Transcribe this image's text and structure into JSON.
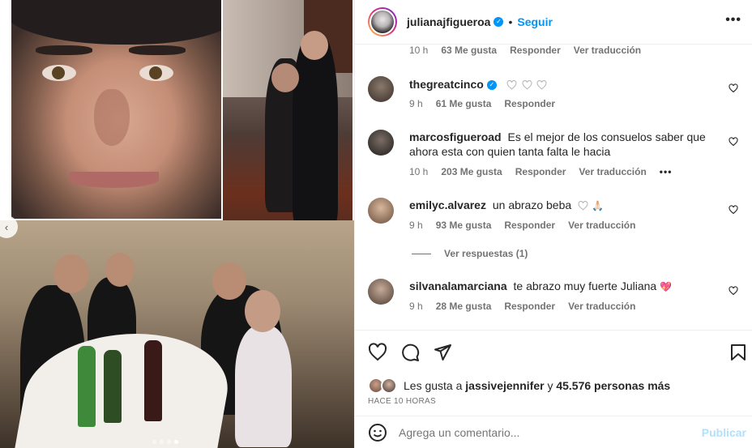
{
  "post": {
    "author": "julianajfigueroa",
    "separator": "•",
    "follow_label": "Seguir",
    "verified_mark": "✓"
  },
  "top_partial_comment": {
    "time": "10 h",
    "likes": "63 Me gusta",
    "reply_label": "Responder",
    "translate_label": "Ver traducción"
  },
  "comments": [
    {
      "username": "thegreatcinco",
      "verified": true,
      "text": "",
      "hearts_count": 3,
      "time": "9 h",
      "likes": "61 Me gusta",
      "reply_label": "Responder"
    },
    {
      "username": "marcosfigueroad",
      "text": "Es el mejor de los consuelos saber que ahora esta con quien tanta falta le hacia",
      "time": "10 h",
      "likes": "203 Me gusta",
      "reply_label": "Responder",
      "translate_label": "Ver traducción",
      "more_label": "•••"
    },
    {
      "username": "emilyc.alvarez",
      "text": "un abrazo beba",
      "emoji": "🙏🏻",
      "time": "9 h",
      "likes": "93 Me gusta",
      "reply_label": "Responder",
      "translate_label": "Ver traducción",
      "view_replies": "Ver respuestas (1)"
    },
    {
      "username": "silvanalamarciana",
      "text": "te abrazo muy fuerte Juliana",
      "emoji": "💖",
      "time": "9 h",
      "likes": "28 Me gusta",
      "reply_label": "Responder",
      "translate_label": "Ver traducción"
    }
  ],
  "likes_summary": {
    "prefix": "Les gusta a",
    "user": "jassivejennifer",
    "connector": "y",
    "count": "45.576 personas más"
  },
  "time_ago": "HACE 10 HORAS",
  "add_comment": {
    "placeholder": "Agrega un comentario...",
    "publish_label": "Publicar"
  },
  "carousel": {
    "total": 4,
    "active": 4
  },
  "colors": {
    "accent": "#0095f6",
    "muted": "#737373",
    "publish_disabled": "#b2dffc",
    "heart_red": "#ed4956"
  },
  "icons": [
    "heart-icon",
    "comment-icon",
    "share-icon",
    "bookmark-icon",
    "emoji-icon",
    "more-icon",
    "chevron-left-icon"
  ]
}
